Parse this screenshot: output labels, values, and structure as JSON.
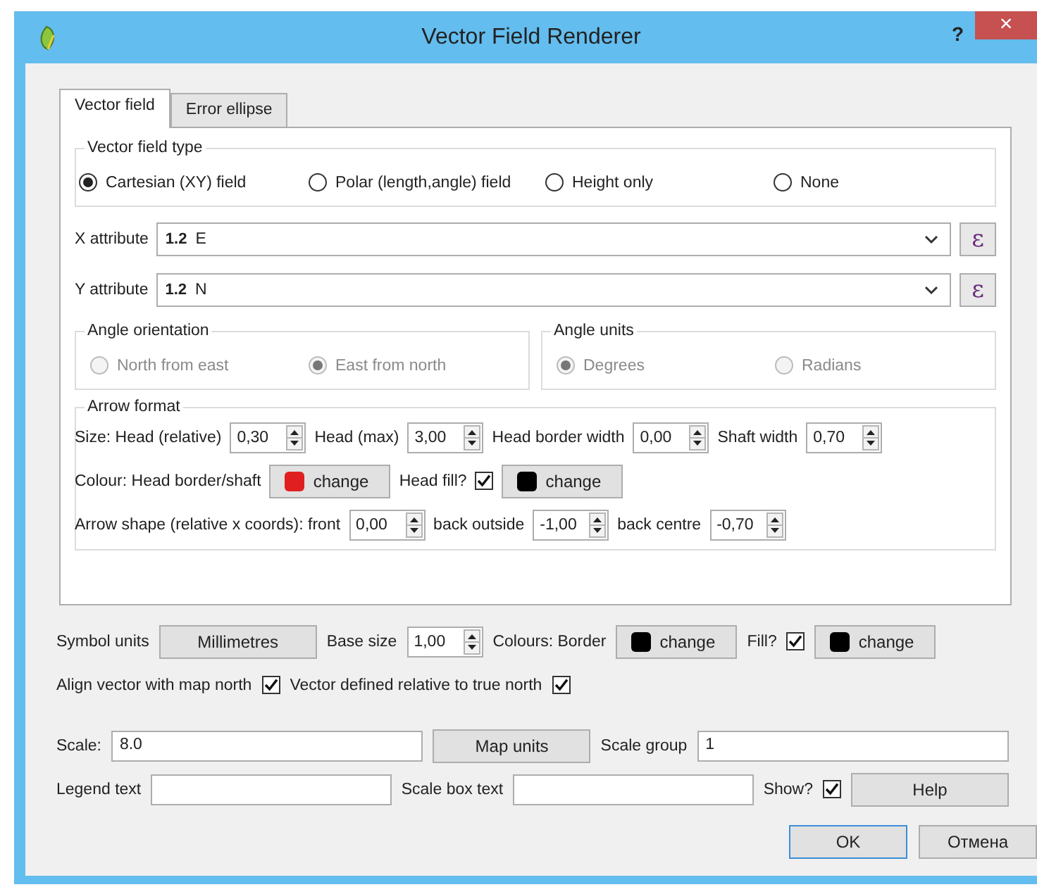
{
  "window": {
    "title": "Vector Field Renderer",
    "help_button": "?",
    "close_button": "×"
  },
  "tabs": [
    {
      "label": "Vector field",
      "selected": true
    },
    {
      "label": "Error ellipse",
      "selected": false
    }
  ],
  "vector_field_type": {
    "title": "Vector field type",
    "options": [
      {
        "label": "Cartesian (XY) field",
        "selected": true
      },
      {
        "label": "Polar (length,angle) field",
        "selected": false
      },
      {
        "label": "Height only",
        "selected": false
      },
      {
        "label": "None",
        "selected": false
      }
    ]
  },
  "attributes": [
    {
      "label": "X attribute",
      "type_badge": "1.2",
      "value": "E",
      "expression_button": "ε"
    },
    {
      "label": "Y attribute",
      "type_badge": "1.2",
      "value": "N",
      "expression_button": "ε"
    }
  ],
  "angle_orientation": {
    "title": "Angle orientation",
    "disabled": true,
    "options": [
      {
        "label": "North from east",
        "selected": false
      },
      {
        "label": "East from north",
        "selected": true
      }
    ]
  },
  "angle_units": {
    "title": "Angle units",
    "disabled": true,
    "options": [
      {
        "label": "Degrees",
        "selected": true
      },
      {
        "label": "Radians",
        "selected": false
      }
    ]
  },
  "arrow_format": {
    "title": "Arrow format",
    "rows": [
      {
        "controls": [
          {
            "kind": "label",
            "text": "Size: Head (relative)"
          },
          {
            "kind": "spin",
            "value": "0,30"
          },
          {
            "kind": "label",
            "text": "Head (max)"
          },
          {
            "kind": "spin",
            "value": "3,00"
          },
          {
            "kind": "label",
            "text": "Head border width"
          },
          {
            "kind": "spin",
            "value": "0,00"
          },
          {
            "kind": "label",
            "text": "Shaft width"
          },
          {
            "kind": "spin",
            "value": "0,70"
          }
        ]
      },
      {
        "controls": [
          {
            "kind": "label",
            "text": "Colour: Head border/shaft"
          },
          {
            "kind": "color_button",
            "label": "change",
            "color": "#e02020"
          },
          {
            "kind": "label",
            "text": "Head fill?"
          },
          {
            "kind": "checkbox",
            "checked": true
          },
          {
            "kind": "color_button",
            "label": "change",
            "color": "#000000"
          }
        ]
      },
      {
        "controls": [
          {
            "kind": "label",
            "text": "Arrow shape (relative x coords): front"
          },
          {
            "kind": "spin",
            "value": "0,00"
          },
          {
            "kind": "label",
            "text": "back outside"
          },
          {
            "kind": "spin",
            "value": "-1,00"
          },
          {
            "kind": "label",
            "text": "back centre"
          },
          {
            "kind": "spin",
            "value": "-0,70"
          }
        ]
      }
    ]
  },
  "option_rows": [
    {
      "controls": [
        {
          "kind": "label",
          "text": "Symbol units"
        },
        {
          "kind": "button",
          "label": "Millimetres"
        },
        {
          "kind": "label",
          "text": "Base size"
        },
        {
          "kind": "spin",
          "value": "1,00"
        },
        {
          "kind": "label",
          "text": "Colours: Border"
        },
        {
          "kind": "color_button",
          "label": "change",
          "color": "#000000"
        },
        {
          "kind": "label",
          "text": "Fill?"
        },
        {
          "kind": "checkbox",
          "checked": true
        },
        {
          "kind": "color_button",
          "label": "change",
          "color": "#000000"
        }
      ]
    },
    {
      "controls": [
        {
          "kind": "label",
          "text": "Align vector with map north"
        },
        {
          "kind": "checkbox",
          "checked": true
        },
        {
          "kind": "label",
          "text": "Vector defined relative to true north"
        },
        {
          "kind": "checkbox",
          "checked": true
        }
      ]
    },
    {
      "controls": [
        {
          "kind": "label",
          "text": "Scale:"
        },
        {
          "kind": "field",
          "value": "8.0"
        },
        {
          "kind": "button",
          "label": "Map units"
        },
        {
          "kind": "label",
          "text": "Scale group"
        },
        {
          "kind": "field",
          "value": "1"
        }
      ]
    },
    {
      "controls": [
        {
          "kind": "label",
          "text": "Legend text"
        },
        {
          "kind": "field"
        },
        {
          "kind": "label",
          "text": "Scale box text"
        },
        {
          "kind": "field"
        },
        {
          "kind": "label",
          "text": "Show?"
        },
        {
          "kind": "checkbox",
          "checked": true
        },
        {
          "kind": "button",
          "label": "Help"
        }
      ]
    }
  ],
  "dialog_buttons": [
    {
      "label": "OK",
      "default": true
    },
    {
      "label": "Отмена",
      "default": false
    }
  ]
}
